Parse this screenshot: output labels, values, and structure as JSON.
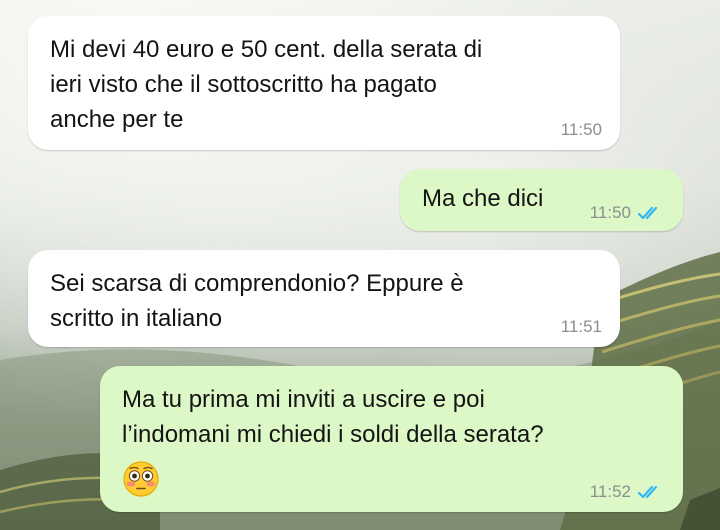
{
  "colors": {
    "incoming_bubble": "#ffffff",
    "outgoing_bubble": "#dcf8c6",
    "timestamp": "#8a8f8c",
    "read_ticks": "#34b7f1"
  },
  "messages": [
    {
      "direction": "incoming",
      "text": "Mi devi 40 euro e 50 cent. della serata di\nieri visto che il sottoscritto ha pagato\nanche per te",
      "time": "11:50"
    },
    {
      "direction": "outgoing",
      "text": "Ma che dici",
      "time": "11:50",
      "status": "read-double-check-icon"
    },
    {
      "direction": "incoming",
      "text": "Sei scarsa di comprendonio? Eppure è\nscritto in italiano",
      "time": "11:51"
    },
    {
      "direction": "outgoing",
      "text": "Ma tu prima mi inviti a uscire e poi\nl’indomani mi chiedi i soldi della serata?",
      "emoji": "flushed-face-emoji",
      "time": "11:52",
      "status": "read-double-check-icon"
    }
  ]
}
